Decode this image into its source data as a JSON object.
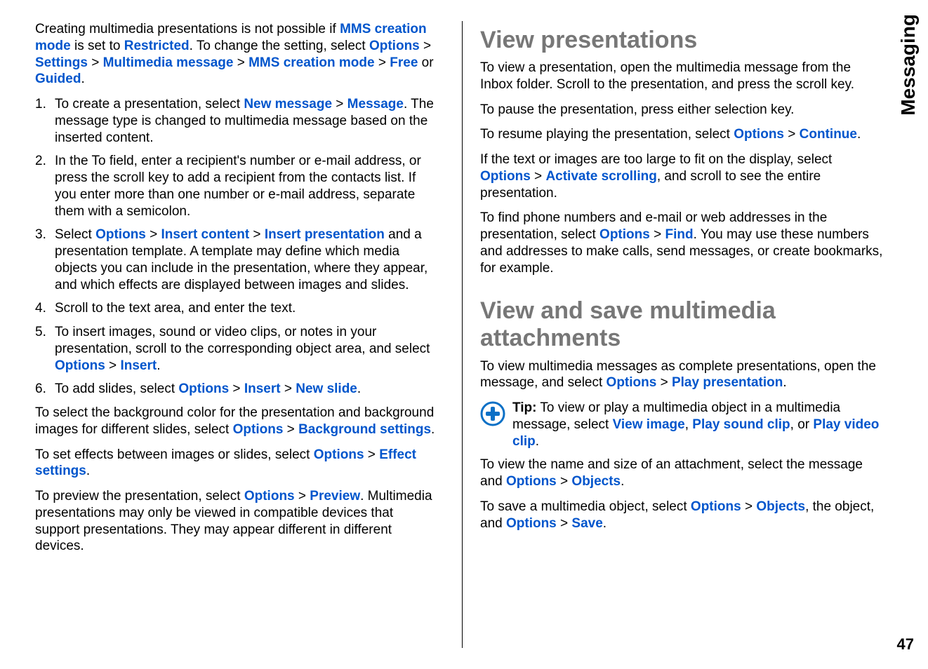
{
  "side_tab": "Messaging",
  "page_number": "47",
  "left": {
    "intro": {
      "t1": "Creating multimedia presentations is not possible if ",
      "l1": "MMS creation mode",
      "t2": " is set to ",
      "l2": "Restricted",
      "t3": ". To change the setting, select ",
      "l3": "Options",
      "t4": " > ",
      "l4": "Settings",
      "t5": " > ",
      "l5": "Multimedia message",
      "t6": " > ",
      "l6": "MMS creation mode",
      "t7": " > ",
      "l7": "Free",
      "t8": " or ",
      "l8": "Guided",
      "t9": "."
    },
    "steps": {
      "s1": {
        "n": "1.",
        "a": "To create a presentation, select ",
        "l1": "New message",
        "b": " > ",
        "l2": "Message",
        "c": ". The message type is changed to multimedia message based on the inserted content."
      },
      "s2": {
        "n": "2.",
        "a": "In the To field, enter a recipient's number or e-mail address, or press the scroll key to add a recipient from the contacts list. If you enter more than one number or e-mail address, separate them with a semicolon."
      },
      "s3": {
        "n": "3.",
        "a": "Select ",
        "l1": "Options",
        "b": " > ",
        "l2": "Insert content",
        "c": " > ",
        "l3": "Insert presentation",
        "d": " and a presentation template. A template may define which media objects you can include in the presentation, where they appear, and which effects are displayed between images and slides."
      },
      "s4": {
        "n": "4.",
        "a": "Scroll to the text area, and enter the text."
      },
      "s5": {
        "n": "5.",
        "a": "To insert images, sound or video clips, or notes in your presentation, scroll to the corresponding object area, and select ",
        "l1": "Options",
        "b": " > ",
        "l2": "Insert",
        "c": "."
      },
      "s6": {
        "n": "6.",
        "a": "To add slides, select ",
        "l1": "Options",
        "b": " > ",
        "l2": "Insert",
        "c": " > ",
        "l3": "New slide",
        "d": "."
      }
    },
    "bg": {
      "a": "To select the background color for the presentation and background images for different slides, select ",
      "l1": "Options",
      "b": " > ",
      "l2": "Background settings",
      "c": "."
    },
    "effects": {
      "a": "To set effects between images or slides, select ",
      "l1": "Options",
      "b": " > ",
      "l2": "Effect settings",
      "c": "."
    },
    "preview": {
      "a": "To preview the presentation, select ",
      "l1": "Options",
      "b": " > ",
      "l2": "Preview",
      "c": ". Multimedia presentations may only be viewed in compatible devices that support presentations. They may appear different in different devices."
    }
  },
  "right": {
    "h1": "View presentations",
    "p1": "To view a presentation, open the multimedia message from the Inbox folder. Scroll to the presentation, and press the scroll key.",
    "p2": "To pause the presentation, press either selection key.",
    "p3": {
      "a": "To resume playing the presentation, select ",
      "l1": "Options",
      "b": " > ",
      "l2": "Continue",
      "c": "."
    },
    "p4": {
      "a": "If the text or images are too large to fit on the display, select ",
      "l1": "Options",
      "b": " > ",
      "l2": "Activate scrolling",
      "c": ", and scroll to see the entire presentation."
    },
    "p5": {
      "a": "To find phone numbers and e-mail or web addresses in the presentation, select ",
      "l1": "Options",
      "b": " > ",
      "l2": "Find",
      "c": ". You may use these numbers and addresses to make calls, send messages, or create bookmarks, for example."
    },
    "h2": "View and save multimedia attachments",
    "p6": {
      "a": "To view multimedia messages as complete presentations, open the message, and select ",
      "l1": "Options",
      "b": " > ",
      "l2": "Play presentation",
      "c": "."
    },
    "tip": {
      "label": "Tip:",
      "a": " To view or play a multimedia object in a multimedia message, select ",
      "l1": "View image",
      "b": ", ",
      "l2": "Play sound clip",
      "c": ", or ",
      "l3": "Play video clip",
      "d": "."
    },
    "p7": {
      "a": "To view the name and size of an attachment, select the message and ",
      "l1": "Options",
      "b": " > ",
      "l2": "Objects",
      "c": "."
    },
    "p8": {
      "a": "To save a multimedia object, select ",
      "l1": "Options",
      "b": " > ",
      "l2": "Objects",
      "c": ", the object, and ",
      "l3": "Options",
      "d": " > ",
      "l4": "Save",
      "e": "."
    }
  }
}
